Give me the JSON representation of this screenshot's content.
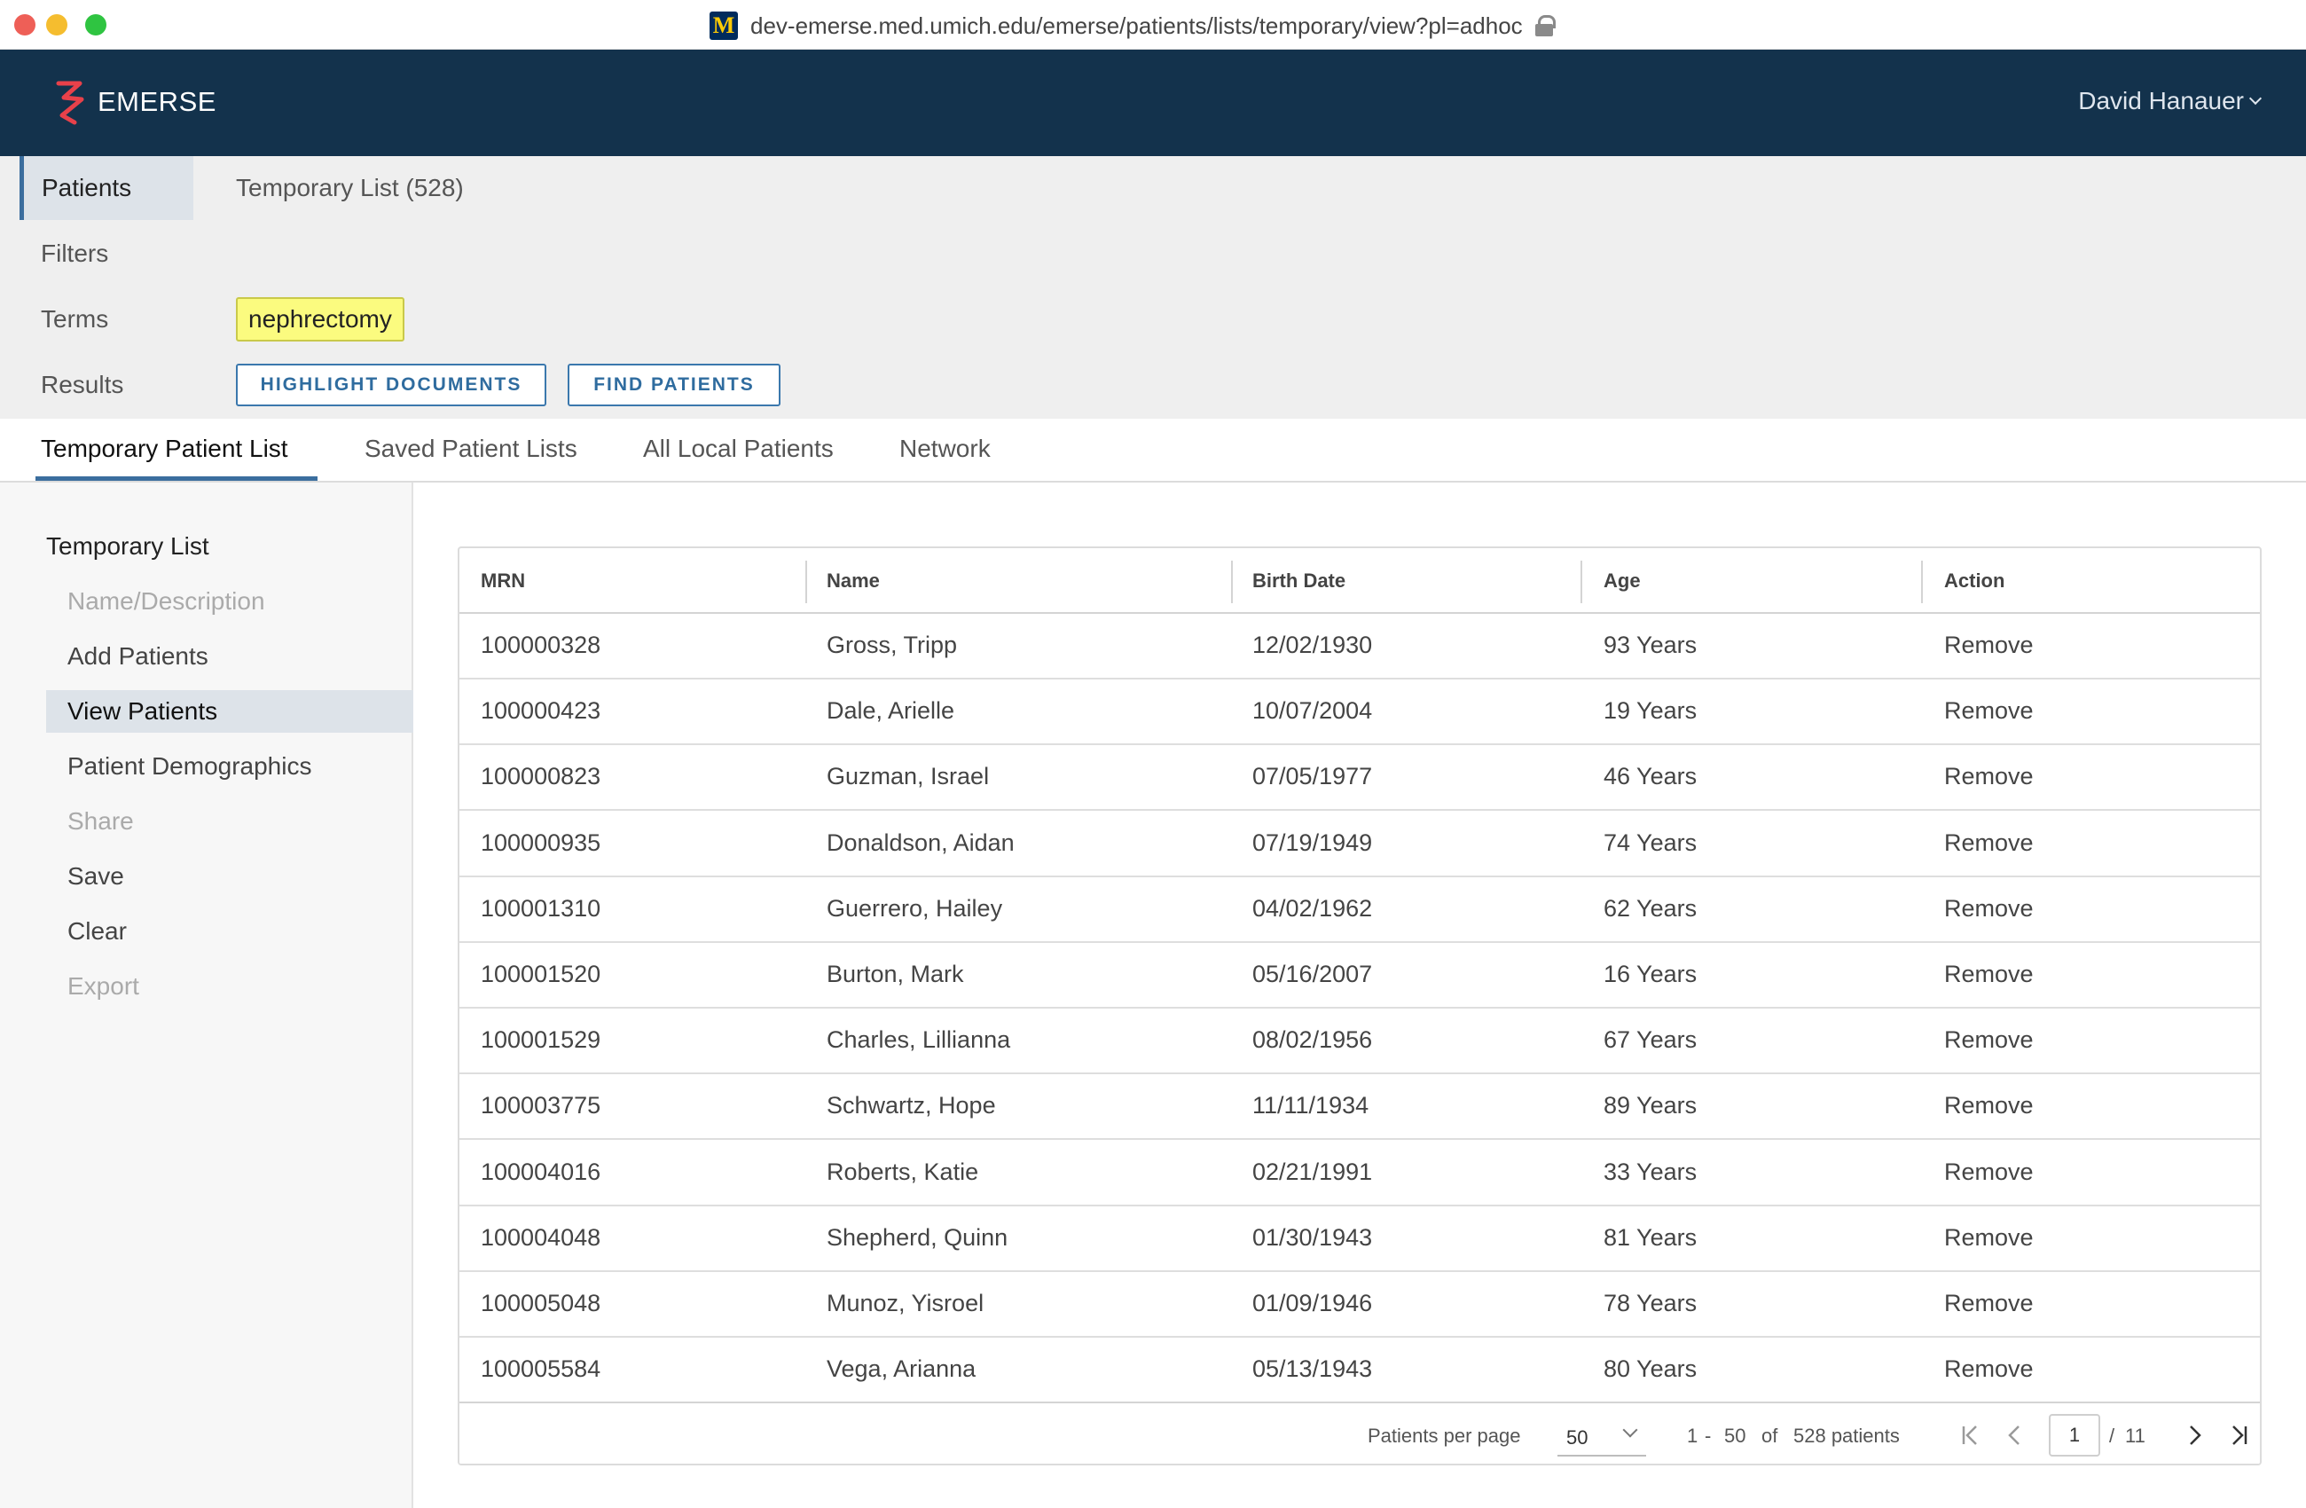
{
  "browser": {
    "url": "dev-emerse.med.umich.edu/emerse/patients/lists/temporary/view?pl=adhoc",
    "favicon_letter": "M"
  },
  "header": {
    "logo_text": "EMERSE",
    "user_name": "David Hanauer",
    "brand_color": "#13324c",
    "logo_color": "#e8414a"
  },
  "summary": {
    "labels": {
      "patients": "Patients",
      "filters": "Filters",
      "terms": "Terms",
      "results": "Results"
    },
    "list_title": "Temporary List (528)",
    "term": "nephrectomy",
    "highlight_button": "HIGHLIGHT DOCUMENTS",
    "find_button": "FIND PATIENTS"
  },
  "tabs": {
    "temporary": "Temporary Patient List",
    "saved": "Saved Patient Lists",
    "all_local": "All Local Patients",
    "network": "Network"
  },
  "sidenav": {
    "heading": "Temporary List",
    "name_description": "Name/Description",
    "add_patients": "Add Patients",
    "view_patients": "View Patients",
    "patient_demographics": "Patient Demographics",
    "share": "Share",
    "save": "Save",
    "clear": "Clear",
    "export": "Export"
  },
  "table": {
    "columns": {
      "mrn": "MRN",
      "name": "Name",
      "birth_date": "Birth Date",
      "age": "Age",
      "action": "Action"
    },
    "rows": [
      {
        "mrn": "100000328",
        "name": "Gross, Tripp",
        "birth_date": "12/02/1930",
        "age": "93 Years",
        "action": "Remove"
      },
      {
        "mrn": "100000423",
        "name": "Dale, Arielle",
        "birth_date": "10/07/2004",
        "age": "19 Years",
        "action": "Remove"
      },
      {
        "mrn": "100000823",
        "name": "Guzman, Israel",
        "birth_date": "07/05/1977",
        "age": "46 Years",
        "action": "Remove"
      },
      {
        "mrn": "100000935",
        "name": "Donaldson, Aidan",
        "birth_date": "07/19/1949",
        "age": "74 Years",
        "action": "Remove"
      },
      {
        "mrn": "100001310",
        "name": "Guerrero, Hailey",
        "birth_date": "04/02/1962",
        "age": "62 Years",
        "action": "Remove"
      },
      {
        "mrn": "100001520",
        "name": "Burton, Mark",
        "birth_date": "05/16/2007",
        "age": "16 Years",
        "action": "Remove"
      },
      {
        "mrn": "100001529",
        "name": "Charles, Lillianna",
        "birth_date": "08/02/1956",
        "age": "67 Years",
        "action": "Remove"
      },
      {
        "mrn": "100003775",
        "name": "Schwartz, Hope",
        "birth_date": "11/11/1934",
        "age": "89 Years",
        "action": "Remove"
      },
      {
        "mrn": "100004016",
        "name": "Roberts, Katie",
        "birth_date": "02/21/1991",
        "age": "33 Years",
        "action": "Remove"
      },
      {
        "mrn": "100004048",
        "name": "Shepherd, Quinn",
        "birth_date": "01/30/1943",
        "age": "81 Years",
        "action": "Remove"
      },
      {
        "mrn": "100005048",
        "name": "Munoz, Yisroel",
        "birth_date": "01/09/1946",
        "age": "78 Years",
        "action": "Remove"
      },
      {
        "mrn": "100005584",
        "name": "Vega, Arianna",
        "birth_date": "05/13/1943",
        "age": "80 Years",
        "action": "Remove"
      }
    ]
  },
  "pagination": {
    "per_page_label": "Patients per page",
    "per_page_value": "50",
    "range_start": "1",
    "range_dash": "-",
    "range_end": "50",
    "of_label": "of",
    "total": "528 patients",
    "current_page": "1",
    "page_sep": "/",
    "total_pages": "11"
  }
}
